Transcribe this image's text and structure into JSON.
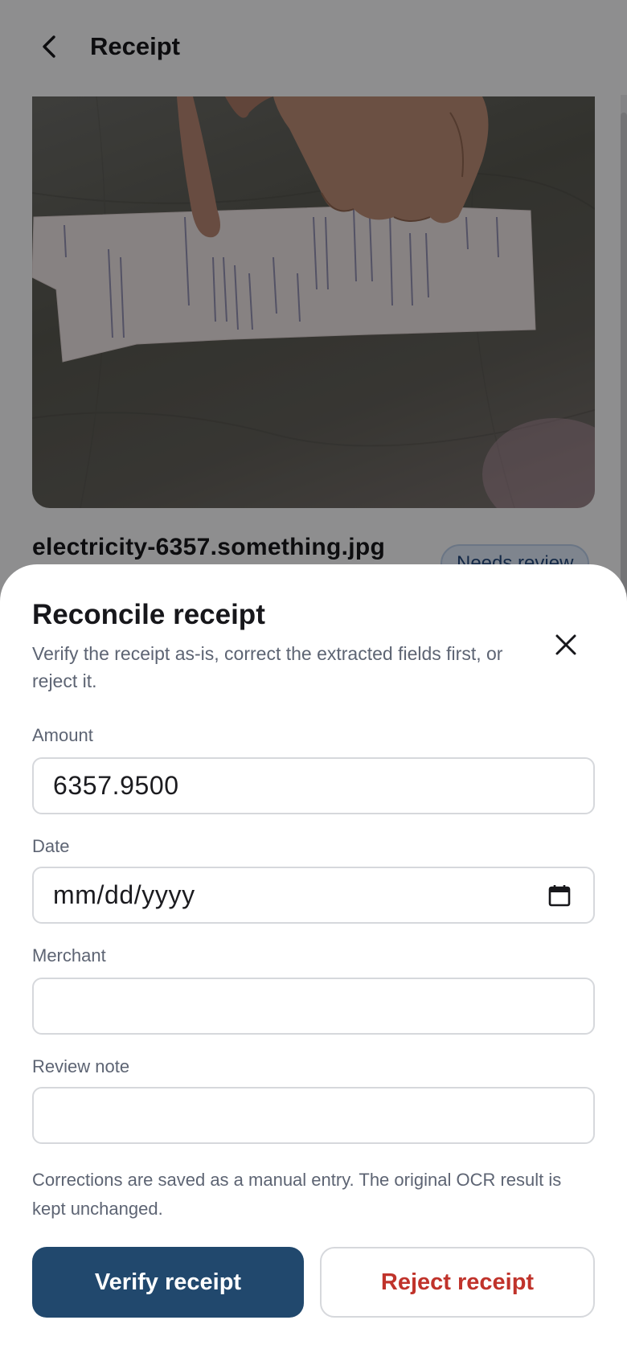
{
  "app_bar": {
    "title": "Receipt",
    "back_icon": "chevron-left-icon"
  },
  "receipt": {
    "file_name": "electricity-6357.something.jpg",
    "status": "Needs review"
  },
  "sheet": {
    "title": "Reconcile receipt",
    "description": "Verify the receipt as-is, correct the extracted fields first, or reject it.",
    "close_icon": "close-icon",
    "fields": {
      "amount": {
        "label": "Amount",
        "value": "6357.9500"
      },
      "date": {
        "label": "Date",
        "placeholder": "mm/dd/yyyy",
        "icon": "calendar-icon"
      },
      "merchant": {
        "label": "Merchant",
        "value": ""
      },
      "review_note": {
        "label": "Review note",
        "value": ""
      }
    },
    "note": "Corrections are saved as a manual entry. The original OCR result is kept unchanged.",
    "verify_label": "Verify receipt",
    "reject_label": "Reject receipt"
  },
  "colors": {
    "primary": "#21486d",
    "danger": "#c0332b",
    "muted_text": "#5d6473",
    "badge_bg": "#dbe6f5"
  }
}
